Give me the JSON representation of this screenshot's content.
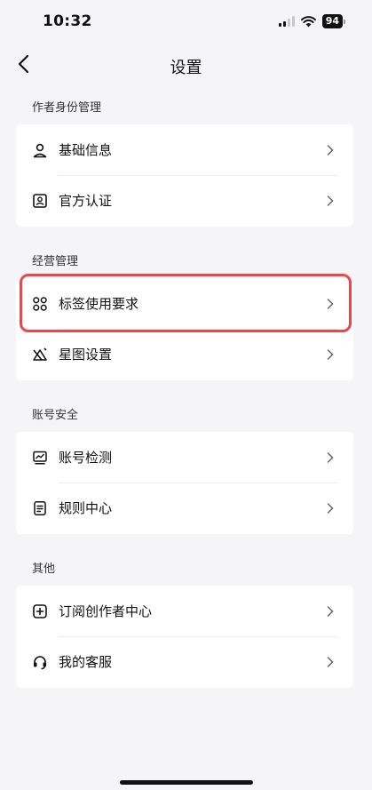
{
  "status_bar": {
    "time": "10:32",
    "battery": "94"
  },
  "nav": {
    "title": "设置"
  },
  "sections": [
    {
      "label": "作者身份管理",
      "items": [
        {
          "label": "基础信息",
          "icon": "person-icon"
        },
        {
          "label": "官方认证",
          "icon": "id-card-icon"
        }
      ]
    },
    {
      "label": "经营管理",
      "items": [
        {
          "label": "标签使用要求",
          "icon": "apps-grid-icon"
        },
        {
          "label": "星图设置",
          "icon": "star-map-icon"
        }
      ]
    },
    {
      "label": "账号安全",
      "items": [
        {
          "label": "账号检测",
          "icon": "monitor-chart-icon"
        },
        {
          "label": "规则中心",
          "icon": "document-icon"
        }
      ]
    },
    {
      "label": "其他",
      "items": [
        {
          "label": "订阅创作者中心",
          "icon": "plus-box-icon"
        },
        {
          "label": "我的客服",
          "icon": "headset-icon"
        }
      ]
    }
  ],
  "colors": {
    "highlight": "#e9474c",
    "background": "#f5f5f7"
  }
}
